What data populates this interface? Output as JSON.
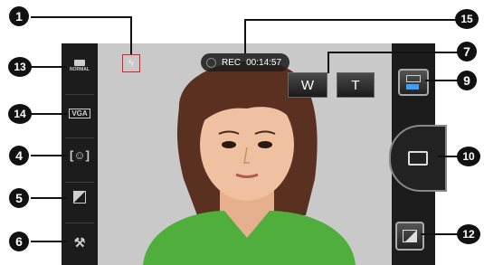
{
  "recording": {
    "label": "REC",
    "elapsed": "00:14:57"
  },
  "zoom": {
    "wide_label": "W",
    "tele_label": "T"
  },
  "left_toolbar": {
    "scene_label": "NORMAL",
    "resolution_label": "VGA"
  },
  "callouts": {
    "c1": "1",
    "c13": "13",
    "c14": "14",
    "c4": "4",
    "c5": "5",
    "c6": "6",
    "c15": "15",
    "c7": "7",
    "c9": "9",
    "c10": "10",
    "c12": "12"
  },
  "icons": {
    "flash_off": "flash-off-icon",
    "scene_mode": "scene-mode-icon",
    "resolution": "resolution-icon",
    "face_detection": "face-detection-icon",
    "exposure": "exposure-icon",
    "settings": "settings-tools-icon",
    "mode_switch": "camera-video-switch-icon",
    "record": "video-record-icon",
    "gallery": "gallery-icon"
  },
  "colors": {
    "flash_outline": "#e02020",
    "rec_pill": "#1e1e1e",
    "toolbar": "#1c1c1c",
    "mode_active": "#3aa0ff"
  }
}
